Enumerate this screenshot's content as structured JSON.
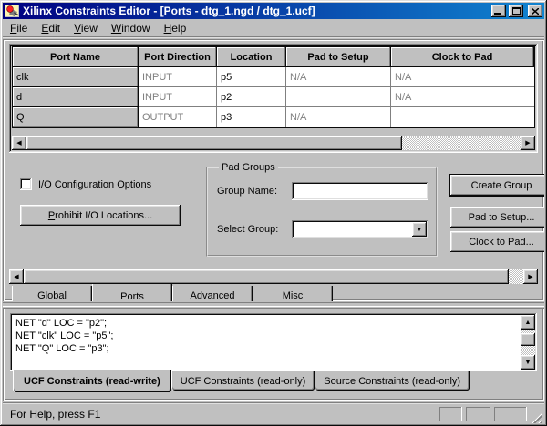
{
  "window": {
    "title": "Xilinx Constraints Editor - [Ports - dtg_1.ngd / dtg_1.ucf]"
  },
  "menu": {
    "items": [
      "File",
      "Edit",
      "View",
      "Window",
      "Help"
    ]
  },
  "ports_table": {
    "columns": [
      "Port Name",
      "Port Direction",
      "Location",
      "Pad to Setup",
      "Clock to Pad"
    ],
    "rows": [
      {
        "name": "clk",
        "direction": "INPUT",
        "location": "p5",
        "pad_to_setup": "N/A",
        "clock_to_pad": "N/A"
      },
      {
        "name": "d",
        "direction": "INPUT",
        "location": "p2",
        "pad_to_setup": "",
        "clock_to_pad": "N/A"
      },
      {
        "name": "Q",
        "direction": "OUTPUT",
        "location": "p3",
        "pad_to_setup": "N/A",
        "clock_to_pad": ""
      }
    ]
  },
  "io_options": {
    "checkbox_label": "I/O Configuration Options",
    "checkbox_checked": false,
    "prohibit_button_label": "Prohibit I/O Locations..."
  },
  "pad_groups": {
    "legend": "Pad Groups",
    "group_name_label": "Group Name:",
    "group_name_value": "",
    "select_group_label": "Select Group:",
    "select_group_value": "",
    "buttons": {
      "create_group": "Create Group",
      "pad_to_setup": "Pad to Setup...",
      "clock_to_pad": "Clock to Pad..."
    }
  },
  "page_tabs": {
    "items": [
      {
        "label": "Global",
        "active": false
      },
      {
        "label": "Ports",
        "active": true
      },
      {
        "label": "Advanced",
        "active": false
      },
      {
        "label": "Misc",
        "active": false
      }
    ]
  },
  "constraints_output": {
    "lines": [
      "NET \"d\" LOC = \"p2\";",
      "NET \"clk\" LOC = \"p5\";",
      "NET \"Q\" LOC = \"p3\";"
    ]
  },
  "file_tabs": {
    "items": [
      {
        "label": "UCF Constraints (read-write)",
        "active": true
      },
      {
        "label": "UCF Constraints (read-only)",
        "active": false
      },
      {
        "label": "Source Constraints (read-only)",
        "active": false
      }
    ]
  },
  "status_bar": {
    "text": "For Help, press F1"
  },
  "icons": {
    "scroll_left": "◀",
    "scroll_right": "▶",
    "scroll_up": "▲",
    "scroll_down": "▼",
    "dropdown": "▼"
  },
  "colors": {
    "titlebar_start": "#000080",
    "titlebar_end": "#1084d0",
    "chrome": "#c0c0c0",
    "disabled_text": "#808080"
  }
}
